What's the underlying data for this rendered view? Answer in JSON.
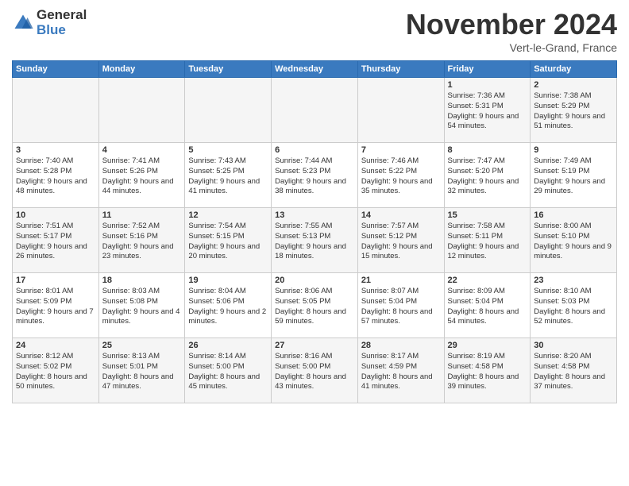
{
  "logo": {
    "general": "General",
    "blue": "Blue"
  },
  "header": {
    "title": "November 2024",
    "location": "Vert-le-Grand, France"
  },
  "weekdays": [
    "Sunday",
    "Monday",
    "Tuesday",
    "Wednesday",
    "Thursday",
    "Friday",
    "Saturday"
  ],
  "weeks": [
    [
      {
        "day": "",
        "content": ""
      },
      {
        "day": "",
        "content": ""
      },
      {
        "day": "",
        "content": ""
      },
      {
        "day": "",
        "content": ""
      },
      {
        "day": "",
        "content": ""
      },
      {
        "day": "1",
        "content": "Sunrise: 7:36 AM\nSunset: 5:31 PM\nDaylight: 9 hours and 54 minutes."
      },
      {
        "day": "2",
        "content": "Sunrise: 7:38 AM\nSunset: 5:29 PM\nDaylight: 9 hours and 51 minutes."
      }
    ],
    [
      {
        "day": "3",
        "content": "Sunrise: 7:40 AM\nSunset: 5:28 PM\nDaylight: 9 hours and 48 minutes."
      },
      {
        "day": "4",
        "content": "Sunrise: 7:41 AM\nSunset: 5:26 PM\nDaylight: 9 hours and 44 minutes."
      },
      {
        "day": "5",
        "content": "Sunrise: 7:43 AM\nSunset: 5:25 PM\nDaylight: 9 hours and 41 minutes."
      },
      {
        "day": "6",
        "content": "Sunrise: 7:44 AM\nSunset: 5:23 PM\nDaylight: 9 hours and 38 minutes."
      },
      {
        "day": "7",
        "content": "Sunrise: 7:46 AM\nSunset: 5:22 PM\nDaylight: 9 hours and 35 minutes."
      },
      {
        "day": "8",
        "content": "Sunrise: 7:47 AM\nSunset: 5:20 PM\nDaylight: 9 hours and 32 minutes."
      },
      {
        "day": "9",
        "content": "Sunrise: 7:49 AM\nSunset: 5:19 PM\nDaylight: 9 hours and 29 minutes."
      }
    ],
    [
      {
        "day": "10",
        "content": "Sunrise: 7:51 AM\nSunset: 5:17 PM\nDaylight: 9 hours and 26 minutes."
      },
      {
        "day": "11",
        "content": "Sunrise: 7:52 AM\nSunset: 5:16 PM\nDaylight: 9 hours and 23 minutes."
      },
      {
        "day": "12",
        "content": "Sunrise: 7:54 AM\nSunset: 5:15 PM\nDaylight: 9 hours and 20 minutes."
      },
      {
        "day": "13",
        "content": "Sunrise: 7:55 AM\nSunset: 5:13 PM\nDaylight: 9 hours and 18 minutes."
      },
      {
        "day": "14",
        "content": "Sunrise: 7:57 AM\nSunset: 5:12 PM\nDaylight: 9 hours and 15 minutes."
      },
      {
        "day": "15",
        "content": "Sunrise: 7:58 AM\nSunset: 5:11 PM\nDaylight: 9 hours and 12 minutes."
      },
      {
        "day": "16",
        "content": "Sunrise: 8:00 AM\nSunset: 5:10 PM\nDaylight: 9 hours and 9 minutes."
      }
    ],
    [
      {
        "day": "17",
        "content": "Sunrise: 8:01 AM\nSunset: 5:09 PM\nDaylight: 9 hours and 7 minutes."
      },
      {
        "day": "18",
        "content": "Sunrise: 8:03 AM\nSunset: 5:08 PM\nDaylight: 9 hours and 4 minutes."
      },
      {
        "day": "19",
        "content": "Sunrise: 8:04 AM\nSunset: 5:06 PM\nDaylight: 9 hours and 2 minutes."
      },
      {
        "day": "20",
        "content": "Sunrise: 8:06 AM\nSunset: 5:05 PM\nDaylight: 8 hours and 59 minutes."
      },
      {
        "day": "21",
        "content": "Sunrise: 8:07 AM\nSunset: 5:04 PM\nDaylight: 8 hours and 57 minutes."
      },
      {
        "day": "22",
        "content": "Sunrise: 8:09 AM\nSunset: 5:04 PM\nDaylight: 8 hours and 54 minutes."
      },
      {
        "day": "23",
        "content": "Sunrise: 8:10 AM\nSunset: 5:03 PM\nDaylight: 8 hours and 52 minutes."
      }
    ],
    [
      {
        "day": "24",
        "content": "Sunrise: 8:12 AM\nSunset: 5:02 PM\nDaylight: 8 hours and 50 minutes."
      },
      {
        "day": "25",
        "content": "Sunrise: 8:13 AM\nSunset: 5:01 PM\nDaylight: 8 hours and 47 minutes."
      },
      {
        "day": "26",
        "content": "Sunrise: 8:14 AM\nSunset: 5:00 PM\nDaylight: 8 hours and 45 minutes."
      },
      {
        "day": "27",
        "content": "Sunrise: 8:16 AM\nSunset: 5:00 PM\nDaylight: 8 hours and 43 minutes."
      },
      {
        "day": "28",
        "content": "Sunrise: 8:17 AM\nSunset: 4:59 PM\nDaylight: 8 hours and 41 minutes."
      },
      {
        "day": "29",
        "content": "Sunrise: 8:19 AM\nSunset: 4:58 PM\nDaylight: 8 hours and 39 minutes."
      },
      {
        "day": "30",
        "content": "Sunrise: 8:20 AM\nSunset: 4:58 PM\nDaylight: 8 hours and 37 minutes."
      }
    ]
  ]
}
